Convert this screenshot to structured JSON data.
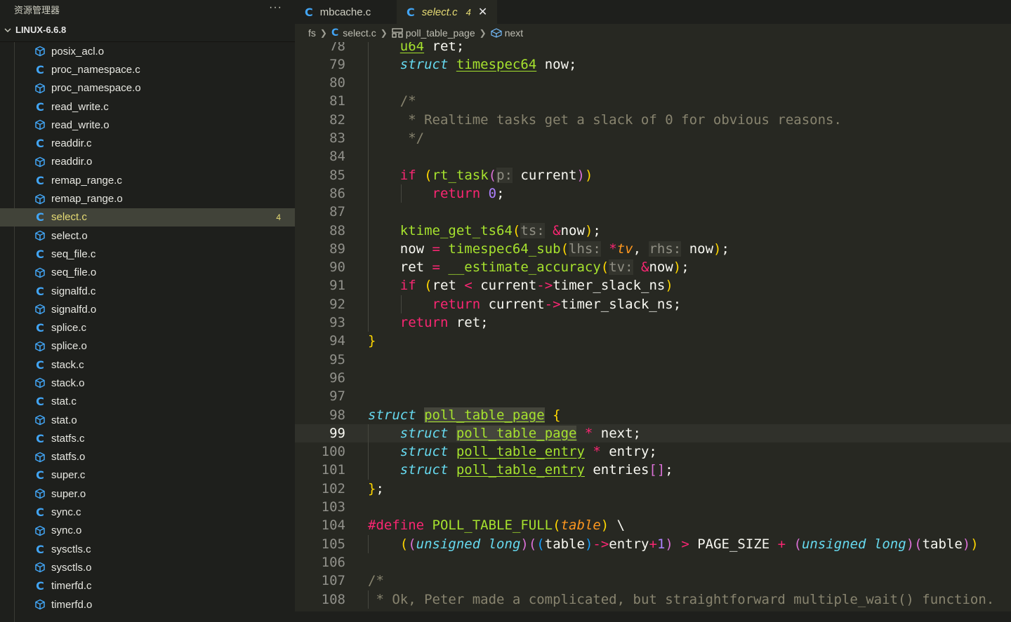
{
  "sidebar": {
    "title": "资源管理器",
    "more": "···",
    "root": "LINUX-6.6.8",
    "files": [
      {
        "name": "posix_acl.o",
        "type": "o"
      },
      {
        "name": "proc_namespace.c",
        "type": "c"
      },
      {
        "name": "proc_namespace.o",
        "type": "o"
      },
      {
        "name": "read_write.c",
        "type": "c"
      },
      {
        "name": "read_write.o",
        "type": "o"
      },
      {
        "name": "readdir.c",
        "type": "c"
      },
      {
        "name": "readdir.o",
        "type": "o"
      },
      {
        "name": "remap_range.c",
        "type": "c"
      },
      {
        "name": "remap_range.o",
        "type": "o"
      },
      {
        "name": "select.c",
        "type": "c",
        "selected": true,
        "badge": "4"
      },
      {
        "name": "select.o",
        "type": "o"
      },
      {
        "name": "seq_file.c",
        "type": "c"
      },
      {
        "name": "seq_file.o",
        "type": "o"
      },
      {
        "name": "signalfd.c",
        "type": "c"
      },
      {
        "name": "signalfd.o",
        "type": "o"
      },
      {
        "name": "splice.c",
        "type": "c"
      },
      {
        "name": "splice.o",
        "type": "o"
      },
      {
        "name": "stack.c",
        "type": "c"
      },
      {
        "name": "stack.o",
        "type": "o"
      },
      {
        "name": "stat.c",
        "type": "c"
      },
      {
        "name": "stat.o",
        "type": "o"
      },
      {
        "name": "statfs.c",
        "type": "c"
      },
      {
        "name": "statfs.o",
        "type": "o"
      },
      {
        "name": "super.c",
        "type": "c"
      },
      {
        "name": "super.o",
        "type": "o"
      },
      {
        "name": "sync.c",
        "type": "c"
      },
      {
        "name": "sync.o",
        "type": "o"
      },
      {
        "name": "sysctls.c",
        "type": "c"
      },
      {
        "name": "sysctls.o",
        "type": "o"
      },
      {
        "name": "timerfd.c",
        "type": "c"
      },
      {
        "name": "timerfd.o",
        "type": "o"
      }
    ]
  },
  "tabs": [
    {
      "label": "mbcache.c",
      "icon": "C",
      "active": false
    },
    {
      "label": "select.c",
      "icon": "C",
      "active": true,
      "badge": "4",
      "close": "✕"
    }
  ],
  "breadcrumb": {
    "folder": "fs",
    "file": "select.c",
    "struct": "poll_table_page",
    "member": "next"
  },
  "colors": {
    "background": "#272822",
    "sidebar": "#1e1f1c",
    "keyword": "#f92672",
    "type": "#66d9ef",
    "function": "#a6e22e",
    "comment": "#88846f",
    "number": "#ae81ff",
    "selected_file": "#e6db74",
    "c_icon": "#42a5f5"
  },
  "editor": {
    "current_line": 99,
    "lines": [
      {
        "n": "78",
        "cur": false,
        "t": [
          [
            "    ",
            ""
          ],
          [
            "u64",
            "t-st"
          ],
          [
            " ret;",
            ""
          ]
        ]
      },
      {
        "n": "79",
        "cur": false,
        "t": [
          [
            "    ",
            ""
          ],
          [
            "struct",
            "t-ty"
          ],
          [
            " ",
            ""
          ],
          [
            "timespec64",
            "t-st"
          ],
          [
            " now;",
            ""
          ]
        ]
      },
      {
        "n": "80",
        "cur": false,
        "t": []
      },
      {
        "n": "81",
        "cur": false,
        "t": [
          [
            "    ",
            ""
          ],
          [
            "/*",
            "t-cm"
          ]
        ]
      },
      {
        "n": "82",
        "cur": false,
        "t": [
          [
            "     ",
            ""
          ],
          [
            "* Realtime tasks get a slack of 0 for obvious reasons.",
            "t-cm"
          ]
        ]
      },
      {
        "n": "83",
        "cur": false,
        "t": [
          [
            "     ",
            ""
          ],
          [
            "*/",
            "t-cm"
          ]
        ]
      },
      {
        "n": "84",
        "cur": false,
        "t": []
      },
      {
        "n": "85",
        "cur": false,
        "t": [
          [
            "    ",
            ""
          ],
          [
            "if",
            "t-kw"
          ],
          [
            " ",
            ""
          ],
          [
            "(",
            "t-b1"
          ],
          [
            "rt_task",
            "t-fn"
          ],
          [
            "(",
            "t-b2"
          ],
          [
            "p:",
            "t-hint"
          ],
          [
            " current",
            ""
          ],
          [
            ")",
            "t-b2"
          ],
          [
            ")",
            "t-b1"
          ]
        ]
      },
      {
        "n": "86",
        "cur": false,
        "t": [
          [
            "        ",
            ""
          ],
          [
            "return",
            "t-kw"
          ],
          [
            " ",
            ""
          ],
          [
            "0",
            "t-num"
          ],
          [
            ";",
            ""
          ]
        ]
      },
      {
        "n": "87",
        "cur": false,
        "t": []
      },
      {
        "n": "88",
        "cur": false,
        "t": [
          [
            "    ",
            ""
          ],
          [
            "ktime_get_ts64",
            "t-fn"
          ],
          [
            "(",
            "t-b1"
          ],
          [
            "ts:",
            "t-hint"
          ],
          [
            " ",
            ""
          ],
          [
            "&",
            "t-op"
          ],
          [
            "now",
            ""
          ],
          [
            ")",
            "t-b1"
          ],
          [
            ";",
            ""
          ]
        ]
      },
      {
        "n": "89",
        "cur": false,
        "t": [
          [
            "    now ",
            ""
          ],
          [
            "=",
            "t-op"
          ],
          [
            " ",
            ""
          ],
          [
            "timespec64_sub",
            "t-fn"
          ],
          [
            "(",
            "t-b1"
          ],
          [
            "lhs:",
            "t-hint"
          ],
          [
            " ",
            ""
          ],
          [
            "*",
            "t-op"
          ],
          [
            "tv",
            "t-par"
          ],
          [
            ", ",
            ""
          ],
          [
            "rhs:",
            "t-hint"
          ],
          [
            " now",
            ""
          ],
          [
            ")",
            "t-b1"
          ],
          [
            ";",
            ""
          ]
        ]
      },
      {
        "n": "90",
        "cur": false,
        "t": [
          [
            "    ret ",
            ""
          ],
          [
            "=",
            "t-op"
          ],
          [
            " ",
            ""
          ],
          [
            "__estimate_accuracy",
            "t-fn"
          ],
          [
            "(",
            "t-b1"
          ],
          [
            "tv:",
            "t-hint"
          ],
          [
            " ",
            ""
          ],
          [
            "&",
            "t-op"
          ],
          [
            "now",
            ""
          ],
          [
            ")",
            "t-b1"
          ],
          [
            ";",
            ""
          ]
        ]
      },
      {
        "n": "91",
        "cur": false,
        "t": [
          [
            "    ",
            ""
          ],
          [
            "if",
            "t-kw"
          ],
          [
            " ",
            ""
          ],
          [
            "(",
            "t-b1"
          ],
          [
            "ret ",
            ""
          ],
          [
            "<",
            "t-op"
          ],
          [
            " current",
            ""
          ],
          [
            "->",
            "t-op"
          ],
          [
            "timer_slack_ns",
            ""
          ],
          [
            ")",
            "t-b1"
          ]
        ]
      },
      {
        "n": "92",
        "cur": false,
        "t": [
          [
            "        ",
            ""
          ],
          [
            "return",
            "t-kw"
          ],
          [
            " current",
            ""
          ],
          [
            "->",
            "t-op"
          ],
          [
            "timer_slack_ns;",
            ""
          ]
        ]
      },
      {
        "n": "93",
        "cur": false,
        "t": [
          [
            "    ",
            ""
          ],
          [
            "return",
            "t-kw"
          ],
          [
            " ret;",
            ""
          ]
        ]
      },
      {
        "n": "94",
        "cur": false,
        "t": [
          [
            "}",
            "t-b1"
          ]
        ]
      },
      {
        "n": "95",
        "cur": false,
        "t": []
      },
      {
        "n": "96",
        "cur": false,
        "t": []
      },
      {
        "n": "97",
        "cur": false,
        "t": []
      },
      {
        "n": "98",
        "cur": false,
        "t": [
          [
            "struct",
            "t-ty"
          ],
          [
            " ",
            ""
          ],
          [
            "poll_table_page",
            "t-st t-hl"
          ],
          [
            " ",
            ""
          ],
          [
            "{",
            "t-b1"
          ]
        ]
      },
      {
        "n": "99",
        "cur": true,
        "t": [
          [
            "    ",
            ""
          ],
          [
            "struct",
            "t-ty"
          ],
          [
            " ",
            ""
          ],
          [
            "poll_table_page",
            "t-st t-hl"
          ],
          [
            " ",
            ""
          ],
          [
            "*",
            "t-op"
          ],
          [
            " next;",
            ""
          ]
        ]
      },
      {
        "n": "100",
        "cur": false,
        "t": [
          [
            "    ",
            ""
          ],
          [
            "struct",
            "t-ty"
          ],
          [
            " ",
            ""
          ],
          [
            "poll_table_entry",
            "t-st"
          ],
          [
            " ",
            ""
          ],
          [
            "*",
            "t-op"
          ],
          [
            " entry;",
            ""
          ]
        ]
      },
      {
        "n": "101",
        "cur": false,
        "t": [
          [
            "    ",
            ""
          ],
          [
            "struct",
            "t-ty"
          ],
          [
            " ",
            ""
          ],
          [
            "poll_table_entry",
            "t-st"
          ],
          [
            " entries",
            ""
          ],
          [
            "[]",
            "t-b2"
          ],
          [
            ";",
            ""
          ]
        ]
      },
      {
        "n": "102",
        "cur": false,
        "t": [
          [
            "}",
            "t-b1"
          ],
          [
            ";",
            ""
          ]
        ]
      },
      {
        "n": "103",
        "cur": false,
        "t": []
      },
      {
        "n": "104",
        "cur": false,
        "t": [
          [
            "#define",
            "t-kw"
          ],
          [
            " ",
            ""
          ],
          [
            "POLL_TABLE_FULL",
            "t-fn"
          ],
          [
            "(",
            "t-b1"
          ],
          [
            "table",
            "t-par"
          ],
          [
            ")",
            "t-b1"
          ],
          [
            " \\",
            ""
          ]
        ]
      },
      {
        "n": "105",
        "cur": false,
        "t": [
          [
            "    ",
            ""
          ],
          [
            "(",
            "t-b1"
          ],
          [
            "(",
            "t-b2"
          ],
          [
            "unsigned long",
            "t-ty"
          ],
          [
            ")",
            "t-b2"
          ],
          [
            "(",
            "t-b2"
          ],
          [
            "(",
            "t-b3"
          ],
          [
            "table",
            ""
          ],
          [
            ")",
            "t-b3"
          ],
          [
            "->",
            "t-op"
          ],
          [
            "entry",
            ""
          ],
          [
            "+",
            "t-op"
          ],
          [
            "1",
            "t-num"
          ],
          [
            ")",
            "t-b2"
          ],
          [
            " ",
            ""
          ],
          [
            ">",
            "t-op"
          ],
          [
            " PAGE_SIZE ",
            ""
          ],
          [
            "+",
            "t-op"
          ],
          [
            " ",
            ""
          ],
          [
            "(",
            "t-b2"
          ],
          [
            "unsigned long",
            "t-ty"
          ],
          [
            ")",
            "t-b2"
          ],
          [
            "(",
            "t-b2"
          ],
          [
            "table",
            ""
          ],
          [
            ")",
            "t-b2"
          ],
          [
            ")",
            "t-b1"
          ]
        ]
      },
      {
        "n": "106",
        "cur": false,
        "t": []
      },
      {
        "n": "107",
        "cur": false,
        "t": [
          [
            "/*",
            "t-cm"
          ]
        ]
      },
      {
        "n": "108",
        "cur": false,
        "t": [
          [
            " ",
            ""
          ],
          [
            "* Ok, Peter made a complicated, but straightforward multiple_wait() function.",
            "t-cm"
          ]
        ]
      }
    ]
  }
}
